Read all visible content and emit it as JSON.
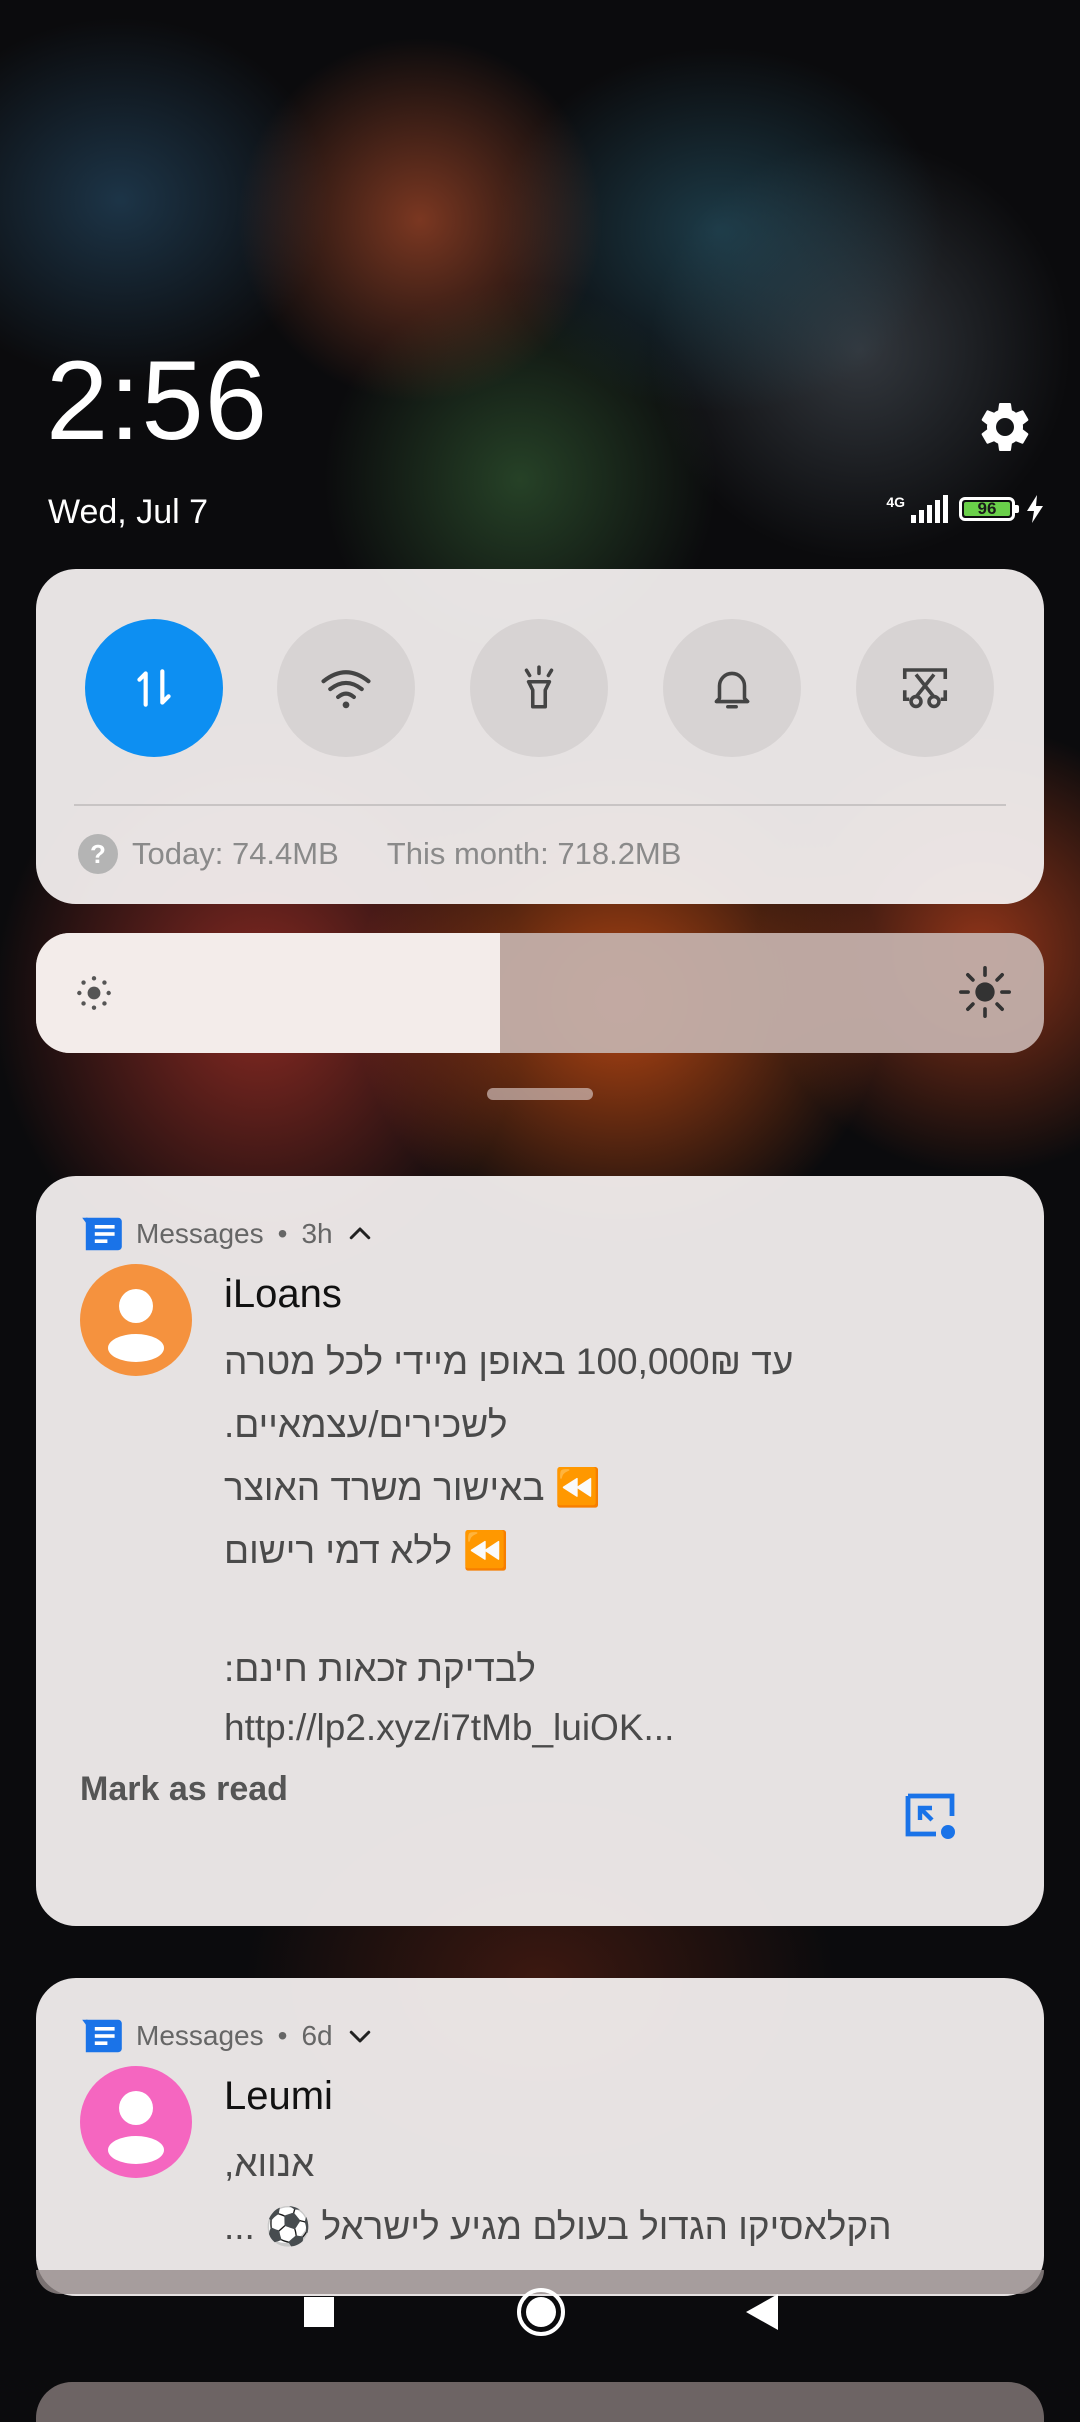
{
  "lockscreen": {
    "time": "2:56",
    "date": "Wed, Jul 7",
    "network_type": "4G",
    "battery_level": "96",
    "charging": true
  },
  "quick_settings": {
    "toggles": [
      {
        "name": "mobile-data",
        "icon": "data-transfer-icon",
        "active": true
      },
      {
        "name": "wifi",
        "icon": "wifi-icon",
        "active": false
      },
      {
        "name": "flashlight",
        "icon": "flashlight-icon",
        "active": false
      },
      {
        "name": "sound",
        "icon": "bell-icon",
        "active": false
      },
      {
        "name": "screenshot",
        "icon": "scissors-icon",
        "active": false
      }
    ],
    "usage_today": "Today: 74.4MB",
    "usage_month": "This month: 718.2MB",
    "brightness_level": 0.46,
    "active_color": "#0d8ff2"
  },
  "notifications": [
    {
      "app": "Messages",
      "time": "3h",
      "expanded": true,
      "sender": "iLoans",
      "avatar_color": "#f5923e",
      "lines": [
        "עד 100,000₪ באופן מיידי לכל מטרה",
        "לשכירים/עצמאיים.",
        "⏪ באישור משרד האוצר",
        "⏪ ללא דמי רישום",
        "",
        "לבדיקת זכאות חינם:",
        "http://lp2.xyz/i7tMb_luiOK..."
      ],
      "action": "Mark as read"
    },
    {
      "app": "Messages",
      "time": "6d",
      "expanded": false,
      "sender": "Leumi",
      "avatar_color": "#f566c0",
      "lines": [
        "אנווא,",
        "הקלאסיקו הגדול בעולם מגיע לישראל ⚽ ..."
      ]
    }
  ]
}
